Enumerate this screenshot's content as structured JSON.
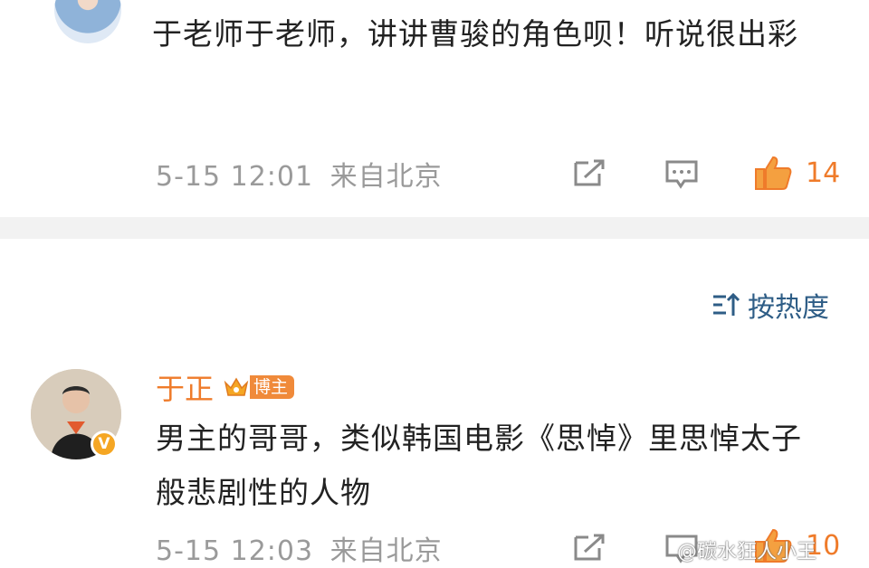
{
  "comments": [
    {
      "text": "于老师于老师，讲讲曹骏的角色呗！听说很出彩",
      "date": "5-15 12:01",
      "location": "来自北京",
      "like_count": "14"
    },
    {
      "author": "于正",
      "badge": "博主",
      "text": "男主的哥哥，类似韩国电影《思悼》里思悼太子般悲剧性的人物",
      "date": "5-15 12:03",
      "location": "来自北京",
      "like_count": "10"
    }
  ],
  "sort": {
    "label": "按热度"
  },
  "watermark": "@碳水狂人小王",
  "colors": {
    "accent_orange": "#ef7b2a",
    "link_blue": "#2e5d86",
    "meta_gray": "#9a9a9a"
  },
  "icons": [
    "share-icon",
    "comment-icon",
    "like-icon",
    "sort-icon",
    "verified-icon",
    "crown-icon"
  ]
}
